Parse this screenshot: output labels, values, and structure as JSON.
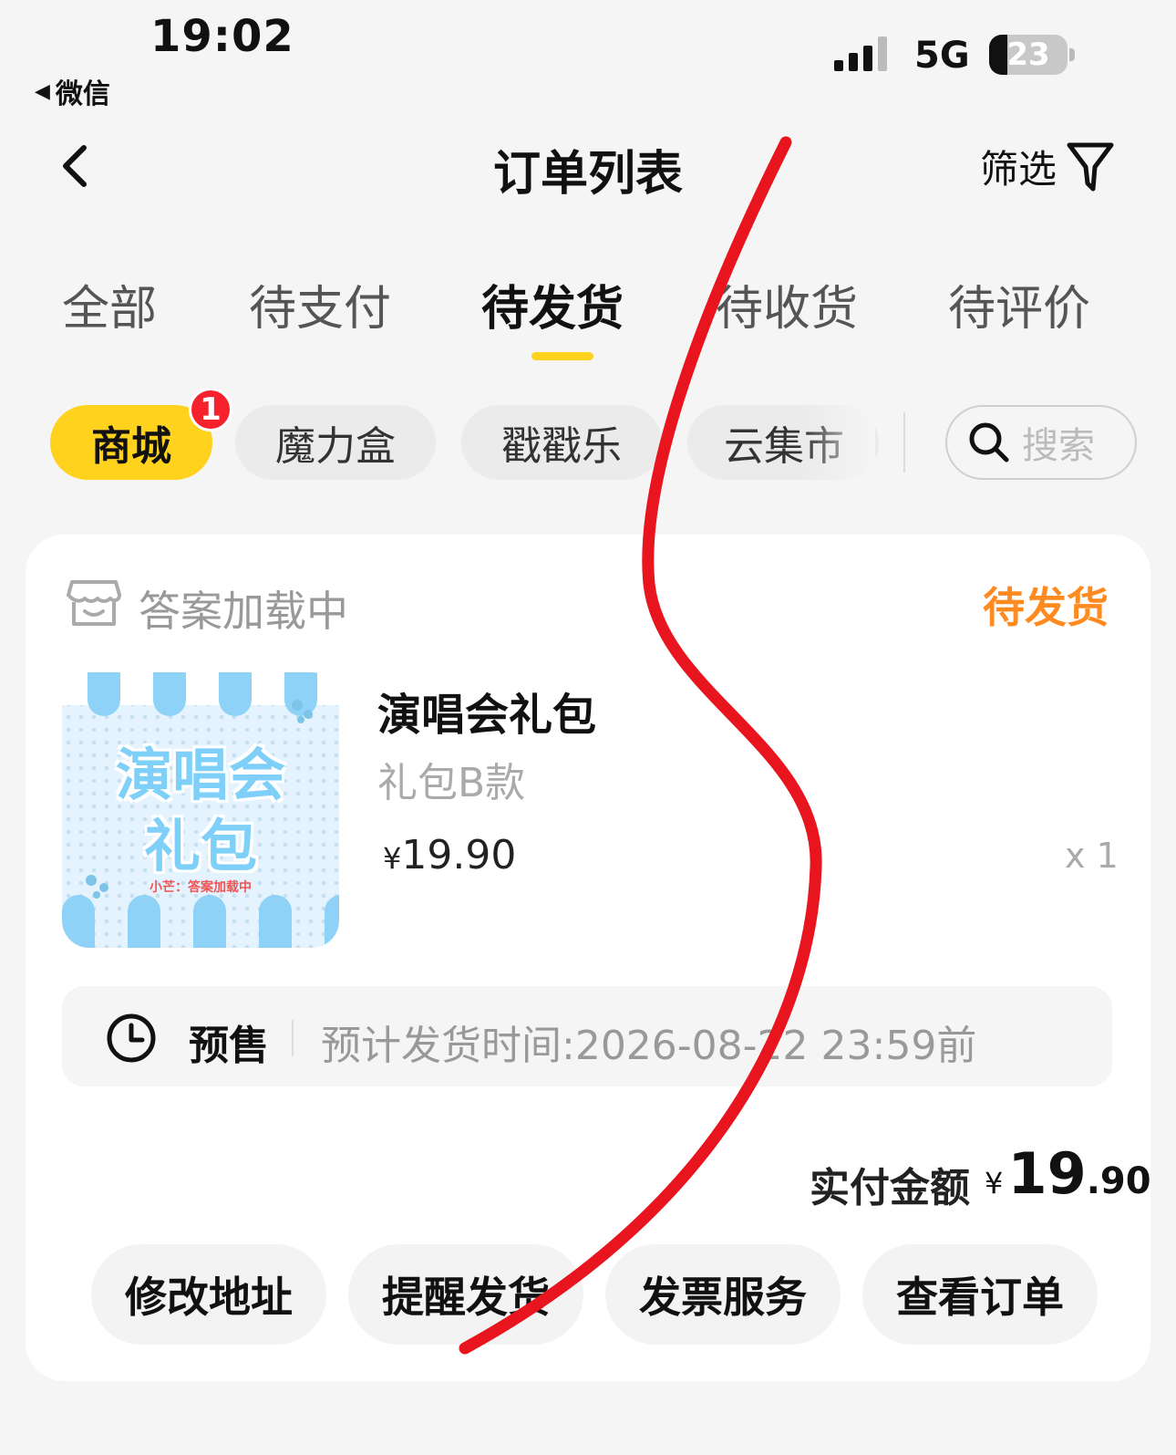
{
  "status_bar": {
    "time": "19:02",
    "back_app": "微信",
    "network": "5G",
    "battery": "23"
  },
  "header": {
    "title": "订单列表",
    "filter_label": "筛选"
  },
  "tabs": [
    {
      "label": "全部"
    },
    {
      "label": "待支付"
    },
    {
      "label": "待发货"
    },
    {
      "label": "待收货"
    },
    {
      "label": "待评价"
    }
  ],
  "chips": [
    {
      "label": "商城"
    },
    {
      "label": "魔力盒"
    },
    {
      "label": "戳戳乐"
    },
    {
      "label": "云集市"
    }
  ],
  "chip_badge": "1",
  "search": {
    "placeholder": "搜索"
  },
  "order": {
    "shop_name": "答案加载中",
    "status": "待发货",
    "thumbnail": {
      "title_line1": "演唱会",
      "title_line2": "礼包",
      "subtitle": "小芒：答案加载中"
    },
    "product_name": "演唱会礼包",
    "variant": "礼包B款",
    "currency": "¥",
    "price": "19.90",
    "quantity": "x 1",
    "presale_tag": "预售",
    "ship_time": "预计发货时间:2026-08-22 23:59前",
    "total_label": "实付金额",
    "total_int": "19",
    "total_dec": ".90",
    "actions": [
      {
        "label": "修改地址"
      },
      {
        "label": "提醒发货"
      },
      {
        "label": "发票服务"
      },
      {
        "label": "查看订单"
      }
    ]
  },
  "colors": {
    "accent_yellow": "#ffd21e",
    "status_orange": "#ff8a1f",
    "badge_red": "#f5222d",
    "scribble_red": "#e8141e"
  }
}
